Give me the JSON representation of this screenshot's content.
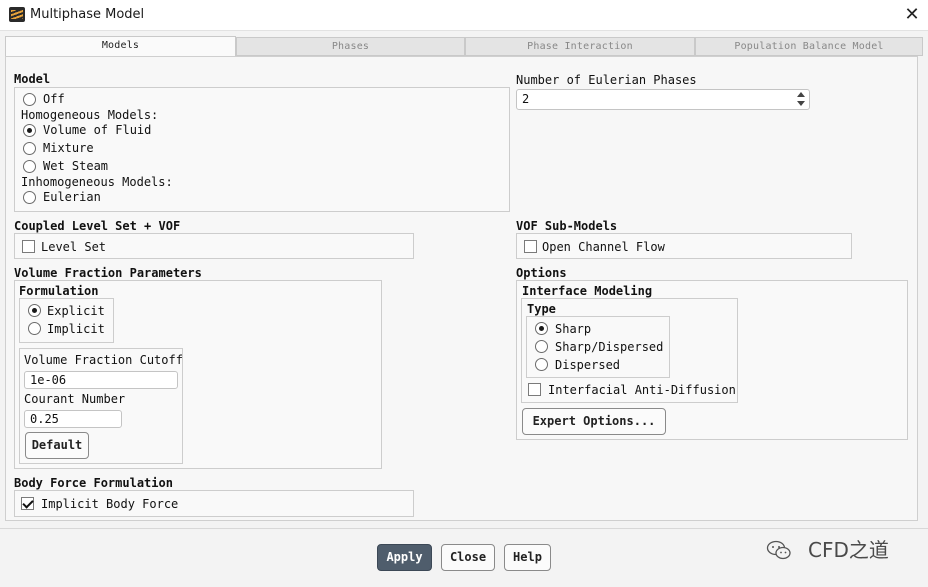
{
  "window": {
    "title": "Multiphase Model",
    "close_glyph": "✕",
    "app_icon": "ansys-fluent-icon"
  },
  "tabs": [
    {
      "label": "Models",
      "active": true
    },
    {
      "label": "Phases",
      "active": false
    },
    {
      "label": "Phase Interaction",
      "active": false
    },
    {
      "label": "Population Balance Model",
      "active": false
    }
  ],
  "model": {
    "title": "Model",
    "off": "Off",
    "homogeneous_heading": "Homogeneous Models:",
    "volume_of_fluid": "Volume of Fluid",
    "mixture": "Mixture",
    "wet_steam": "Wet Steam",
    "inhomogeneous_heading": "Inhomogeneous Models:",
    "eulerian": "Eulerian",
    "selected": "Volume of Fluid"
  },
  "eulerian_phases": {
    "label": "Number of Eulerian Phases",
    "value": "2"
  },
  "coupled_level_set": {
    "title": "Coupled Level Set + VOF",
    "level_set_label": "Level Set",
    "level_set_checked": false
  },
  "vof_sub_models": {
    "title": "VOF Sub-Models",
    "open_channel_label": "Open Channel Flow",
    "open_channel_checked": false
  },
  "volume_fraction": {
    "title": "Volume Fraction Parameters",
    "formulation_title": "Formulation",
    "explicit": "Explicit",
    "implicit": "Implicit",
    "selected": "Explicit",
    "cutoff_label": "Volume Fraction Cutoff",
    "cutoff_value": "1e-06",
    "courant_label": "Courant Number",
    "courant_value": "0.25",
    "default_button": "Default"
  },
  "options": {
    "title": "Options",
    "interface_modeling_title": "Interface Modeling",
    "type_title": "Type",
    "sharp": "Sharp",
    "sharp_dispersed": "Sharp/Dispersed",
    "dispersed": "Dispersed",
    "selected": "Sharp",
    "anti_diffusion_label": "Interfacial Anti-Diffusion",
    "anti_diffusion_checked": false,
    "expert_button": "Expert Options..."
  },
  "body_force": {
    "title": "Body Force Formulation",
    "implicit_label": "Implicit Body Force",
    "implicit_checked": true
  },
  "footer": {
    "apply": "Apply",
    "close": "Close",
    "help": "Help"
  },
  "watermark": {
    "text": "CFD之道",
    "icon": "wechat-icon"
  },
  "colors": {
    "primary_button": "#4f5d6c",
    "panel_bg": "#f7f7f7",
    "window_bg": "#f3f3f3"
  }
}
